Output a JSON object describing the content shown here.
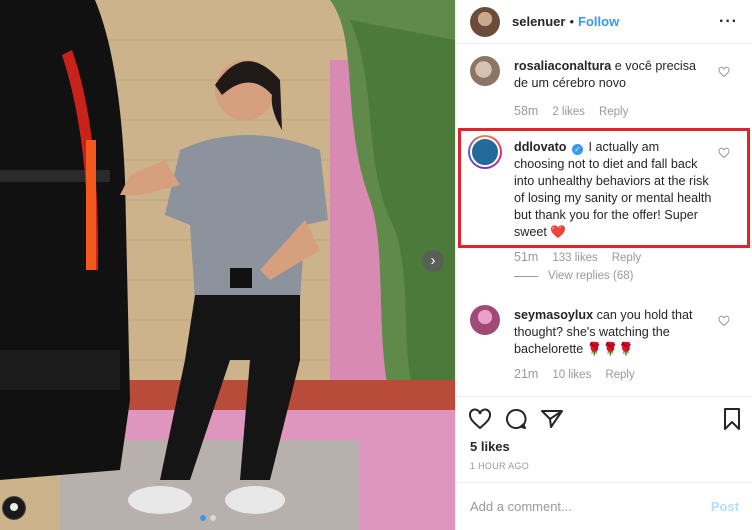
{
  "header": {
    "username": "selenuer",
    "separator": "•",
    "follow_label": "Follow",
    "more_label": "···"
  },
  "comments": [
    {
      "username": "rosaliaconaltura",
      "text": " e você precisa de um cérebro novo",
      "time": "58m",
      "likes": "2 likes",
      "reply_label": "Reply"
    },
    {
      "username": "ddlovato",
      "verified": true,
      "text": " I actually am choosing not to diet and fall back into unhealthy behaviors at the risk of losing my sanity or mental health but thank you for the offer! Super sweet ",
      "emoji": "❤️",
      "time": "51m",
      "likes": "133 likes",
      "reply_label": "Reply",
      "view_replies": "View replies (68)"
    },
    {
      "username": "seymasoylux",
      "text": " can you hold that thought? she's watching the bachelorette ",
      "emoji": "🌹🌹🌹",
      "time": "21m",
      "likes": "10 likes",
      "reply_label": "Reply"
    }
  ],
  "post": {
    "likes": "5 likes",
    "time_ago": "1 HOUR AGO"
  },
  "add_comment": {
    "placeholder": "Add a comment...",
    "post_label": "Post"
  },
  "colors": {
    "link": "#3897f0",
    "highlight_border": "#e2232b",
    "muted": "#999999"
  },
  "icons": [
    "heart-icon",
    "comment-icon",
    "share-icon",
    "bookmark-icon",
    "chevron-right-icon"
  ],
  "carousel": {
    "slides": 2,
    "active": 1
  }
}
